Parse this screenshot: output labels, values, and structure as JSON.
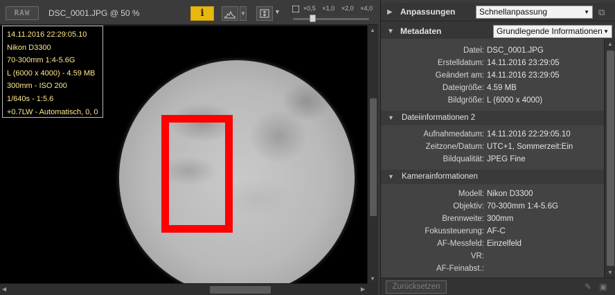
{
  "viewer": {
    "raw_badge": "RAW",
    "file_title": "DSC_0001.JPG @ 50 %",
    "info_button": "i",
    "zoom_levels": [
      "×0,5",
      "×1,0",
      "×2,0",
      "×4,0"
    ],
    "shooting_info": [
      "14.11.2016 22:29:05.10",
      "Nikon D3300",
      "70-300mm 1:4-5.6G",
      "L (6000 x 4000) - 4.59 MB",
      "300mm - ISO 200",
      "1/640s - 1:5.6",
      "+0.7LW - Automatisch, 0, 0"
    ]
  },
  "panel": {
    "adjustments": {
      "title": "Anpassungen",
      "select_value": "Schnellanpassung"
    },
    "metadata": {
      "title": "Metadaten",
      "select_value": "Grundlegende Informationen",
      "file_rows": [
        {
          "label": "Datei:",
          "value": "DSC_0001.JPG"
        },
        {
          "label": "Erstelldatum:",
          "value": "14.11.2016 23:29:05"
        },
        {
          "label": "Geändert am:",
          "value": "14.11.2016 23:29:05"
        },
        {
          "label": "Dateigröße:",
          "value": "4.59 MB"
        },
        {
          "label": "Bildgröße:",
          "value": "L (6000 x 4000)"
        }
      ],
      "file_info2_title": "Dateiinformationen 2",
      "file_info2_rows": [
        {
          "label": "Aufnahmedatum:",
          "value": "14.11.2016 22:29:05.10"
        },
        {
          "label": "Zeitzone/Datum:",
          "value": "UTC+1, Sommerzeit:Ein"
        },
        {
          "label": "Bildqualität:",
          "value": "JPEG Fine"
        }
      ],
      "camera_info_title": "Kamerainformationen",
      "camera_rows": [
        {
          "label": "Modell:",
          "value": "Nikon D3300"
        },
        {
          "label": "Objektiv:",
          "value": "70-300mm 1:4-5.6G"
        },
        {
          "label": "Brennweite:",
          "value": "300mm"
        },
        {
          "label": "Fokussteuerung:",
          "value": "AF-C"
        },
        {
          "label": "AF-Messfeld:",
          "value": "Einzelfeld"
        },
        {
          "label": "VR:",
          "value": ""
        },
        {
          "label": "AF-Feinabst.:",
          "value": ""
        }
      ]
    },
    "footer": {
      "reset_label": "Zurücksetzen"
    }
  },
  "colors": {
    "info_button": "#e8b80e",
    "overlay_text": "#ffe98c",
    "highlight_box": "#ff0000",
    "panel_bg": "#434343"
  }
}
